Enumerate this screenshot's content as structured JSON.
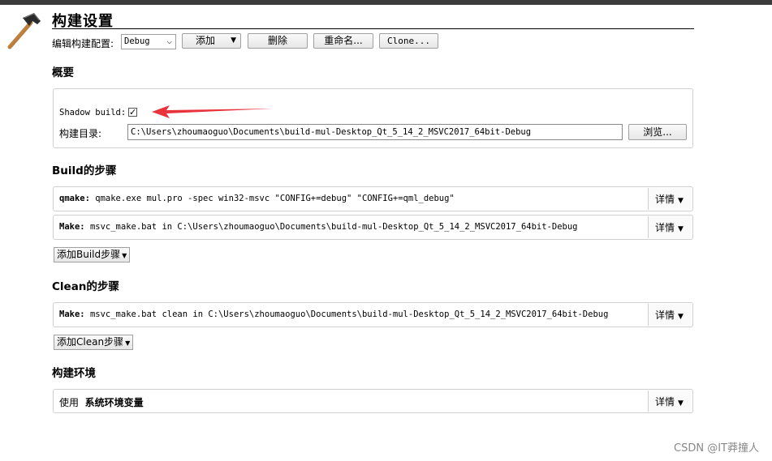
{
  "header": {
    "title": "构建设置",
    "config_label": "编辑构建配置:",
    "config_select": "Debug",
    "add_button": "添加",
    "delete_button": "删除",
    "rename_button": "重命名...",
    "clone_button": "Clone..."
  },
  "overview": {
    "heading": "概要",
    "shadow_build_label": "Shadow build:",
    "shadow_build_checked": "✓",
    "build_dir_label": "构建目录:",
    "build_dir_value": "C:\\Users\\zhoumaoguo\\Documents\\build-mul-Desktop_Qt_5_14_2_MSVC2017_64bit-Debug",
    "browse_button": "浏览..."
  },
  "build_steps": {
    "heading": "Build的步骤",
    "steps": [
      {
        "name": "qmake:",
        "text": "qmake.exe mul.pro -spec win32-msvc \"CONFIG+=debug\" \"CONFIG+=qml_debug\"",
        "detail": "详情"
      },
      {
        "name": "Make:",
        "text": "msvc_make.bat in C:\\Users\\zhoumaoguo\\Documents\\build-mul-Desktop_Qt_5_14_2_MSVC2017_64bit-Debug",
        "detail": "详情"
      }
    ],
    "add_button": "添加Build步骤"
  },
  "clean_steps": {
    "heading": "Clean的步骤",
    "steps": [
      {
        "name": "Make:",
        "text": "msvc_make.bat clean in C:\\Users\\zhoumaoguo\\Documents\\build-mul-Desktop_Qt_5_14_2_MSVC2017_64bit-Debug",
        "detail": "详情"
      }
    ],
    "add_button": "添加Clean步骤"
  },
  "build_env": {
    "heading": "构建环境",
    "use_label": "使用",
    "env_name": "系统环境变量",
    "detail": "详情"
  },
  "watermark": "CSDN @IT莽撞人",
  "colors": {
    "arrow": "#e8323c",
    "topbar": "#3c3c3c"
  }
}
